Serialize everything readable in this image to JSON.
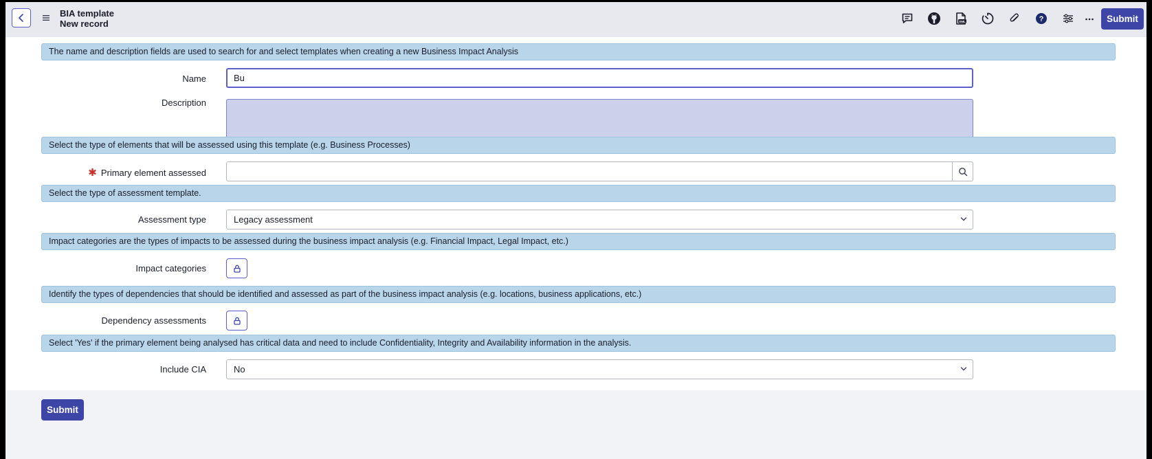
{
  "header": {
    "title": "BIA template",
    "subtitle": "New record",
    "icons": [
      "back-icon",
      "menu-icon",
      "comment-icon",
      "github-icon",
      "xml-document-icon",
      "timer-icon",
      "paperclip-icon",
      "help-icon",
      "settings-sliders-icon",
      "more-icon"
    ],
    "submit_label": "Submit"
  },
  "form": {
    "section1": "The name and description fields are used to search for and select templates when creating a new Business Impact Analysis",
    "name_label": "Name",
    "name_value": "Bu",
    "description_label": "Description",
    "description_value": "",
    "section2": "Select the type of elements that will be assessed using this template (e.g. Business Processes)",
    "required_marker": "✱",
    "primary_label": "Primary element assessed",
    "primary_value": "",
    "section3": "Select the type of assessment template.",
    "assessment_label": "Assessment type",
    "assessment_value": "Legacy assessment",
    "section4": "Impact categories are the types of impacts to be assessed during the business impact analysis (e.g. Financial Impact, Legal Impact, etc.)",
    "impact_label": "Impact categories",
    "section5": "Identify the types of dependencies that should be identified and assessed as part of the business impact analysis (e.g. locations, business applications, etc.)",
    "dependency_label": "Dependency assessments",
    "section6": "Select 'Yes' if the primary element being analysed has critical data and need to include Confidentiality, Integrity and Availability information in the analysis.",
    "cia_label": "Include CIA",
    "cia_value": "No"
  },
  "footer": {
    "submit_label": "Submit"
  },
  "colors": {
    "primary": "#3d45a6",
    "section_bg": "#b8d5ea",
    "focus_border": "#5b5fc7",
    "description_bg": "#ccd0ea",
    "required": "#c8302a"
  }
}
